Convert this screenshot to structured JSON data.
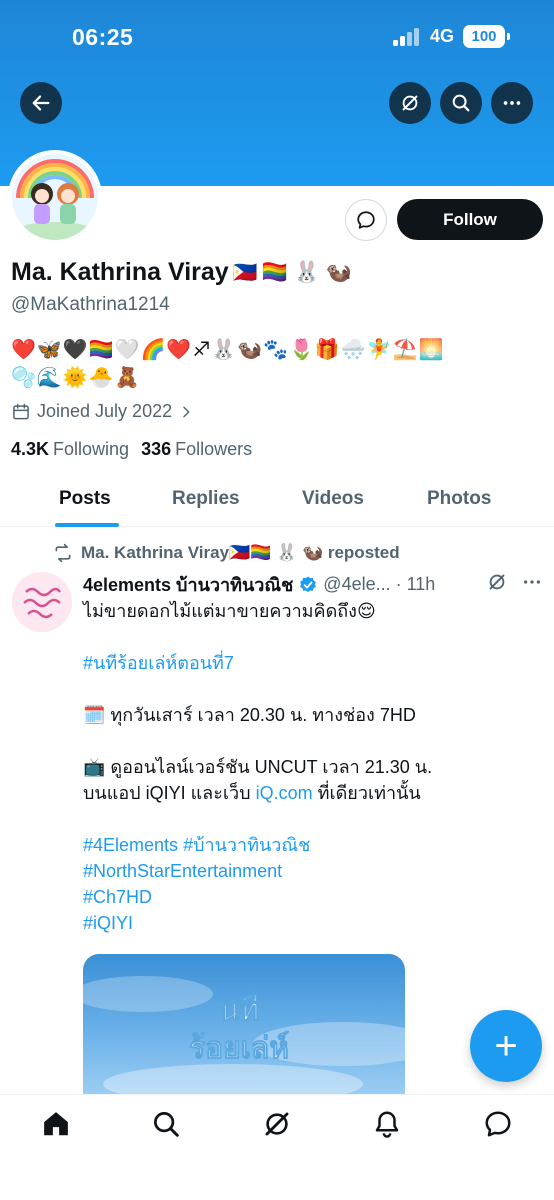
{
  "status": {
    "time": "06:25",
    "network": "4G",
    "battery": "100"
  },
  "profile": {
    "display_name": "Ma. Kathrina Viray",
    "name_flag": "🇵🇭",
    "name_emojis": "🏳️‍🌈 🐰 🦦",
    "handle": "@MaKathrina1214",
    "bio_line1": "❤️🦋🖤🏳️‍🌈🤍🌈❤️♐🐰🦦🐾🌷🎁🌨️🧚⛱️🌅",
    "bio_line2": "🫧🌊🌞🐣🧸",
    "joined": "Joined July 2022",
    "following_count": "4.3K",
    "following_label": "Following",
    "followers_count": "336",
    "followers_label": "Followers"
  },
  "actions": {
    "follow_label": "Follow"
  },
  "tabs": [
    "Posts",
    "Replies",
    "Videos",
    "Photos"
  ],
  "post": {
    "reposter": "Ma. Kathrina Viray🇵🇭🏳️‍🌈 🐰 🦦 reposted",
    "author_name": "4elements บ้านวาทินวณิช",
    "author_handle": "@4ele...",
    "time": "· 11h",
    "line1": "ไม่ขายดอกไม้แต่มาขายความคิดถึง😌",
    "hashtag1": "#นทีร้อยเล่ห์ตอนที่7",
    "line2": "🗓️ ทุกวันเสาร์ เวลา 20.30 น. ทางช่อง 7HD",
    "line3a": "📺 ดูออนไลน์เวอร์ชัน UNCUT เวลา 21.30 น.",
    "line3b_pre": "บนแอป iQIYI และเว็บ ",
    "line3b_link": "iQ.com",
    "line3b_post": " ที่เดียวเท่านั้น",
    "tag_a": "#4Elements",
    "tag_b": "#บ้านวาทินวณิช",
    "tag_c": "#NorthStarEntertainment",
    "tag_d": "#Ch7HD",
    "tag_e": "#iQIYI",
    "image_title_1": "นที",
    "image_title_2": "ร้อยเล่ห์"
  },
  "fab": {
    "label": "+"
  },
  "colors": {
    "accent": "#1d9bf0",
    "text": "#0f1419",
    "muted": "#536471"
  }
}
